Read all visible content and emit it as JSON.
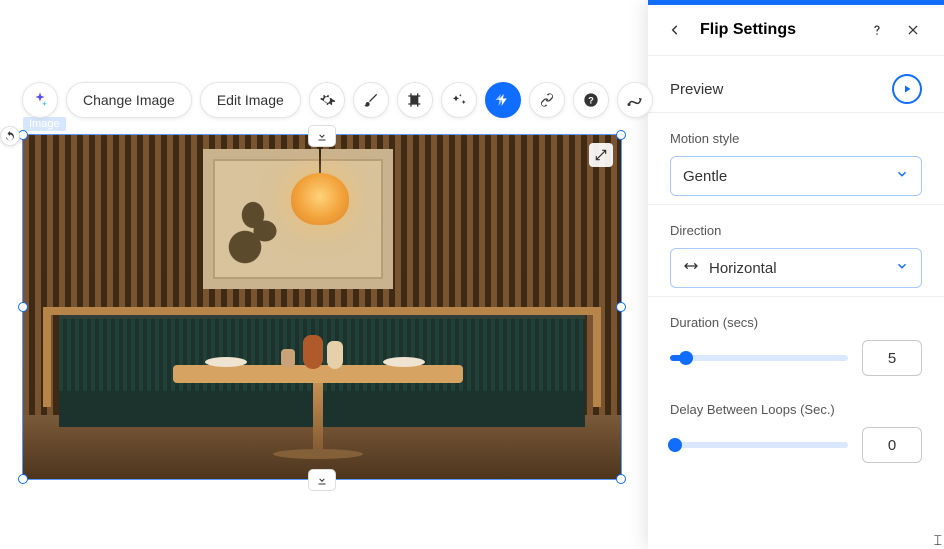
{
  "toolbar": {
    "change_image": "Change Image",
    "edit_image": "Edit Image",
    "icons": {
      "sparkle": "ai-sparkle-icon",
      "gear": "gear-icon",
      "brush": "brush-icon",
      "crop": "crop-icon",
      "wand": "magic-wand-icon",
      "animate": "animate-icon",
      "link": "link-icon",
      "help": "help-icon",
      "motion_path": "motion-path-icon"
    }
  },
  "canvas": {
    "label": "Image"
  },
  "panel": {
    "title": "Flip Settings",
    "preview_label": "Preview",
    "motion_style": {
      "label": "Motion style",
      "value": "Gentle"
    },
    "direction": {
      "label": "Direction",
      "value": "Horizontal"
    },
    "duration": {
      "label": "Duration (secs)",
      "value": "5",
      "fill_pct": 9
    },
    "delay": {
      "label": "Delay Between Loops (Sec.)",
      "value": "0",
      "fill_pct": 0
    }
  }
}
